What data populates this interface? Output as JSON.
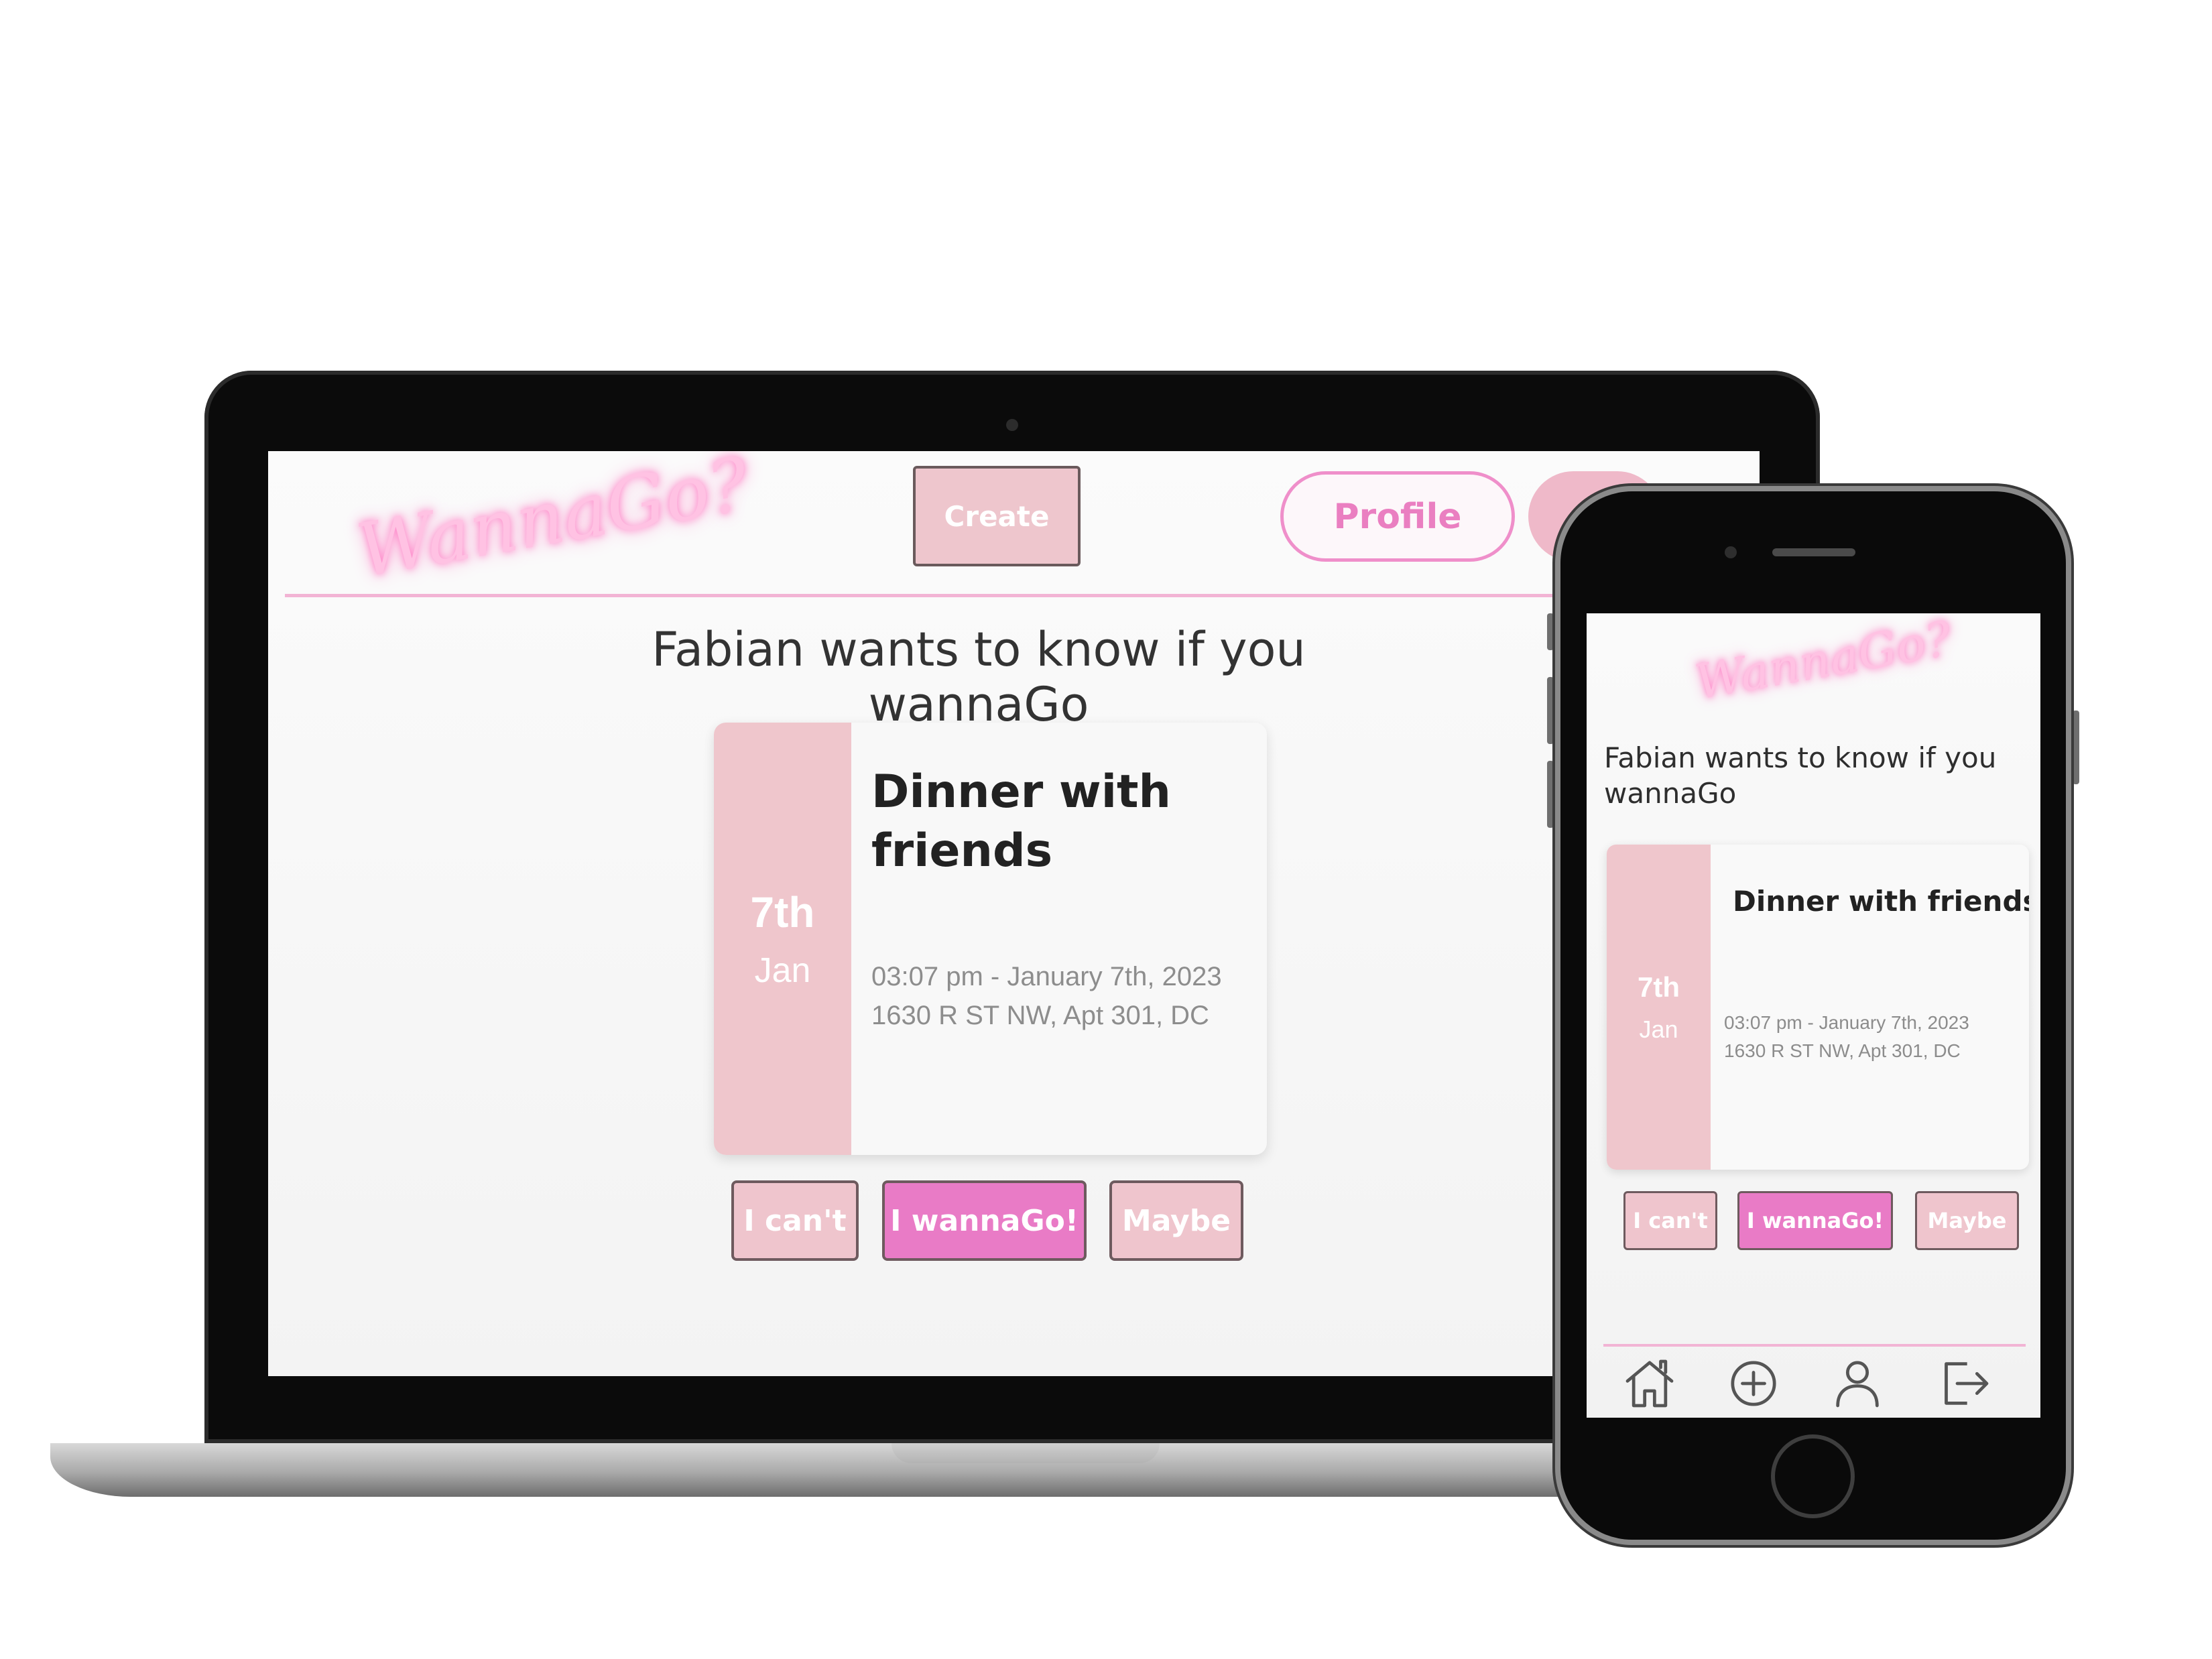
{
  "app": {
    "logo_text": "WannaGo?"
  },
  "laptop": {
    "header": {
      "create_label": "Create",
      "profile_label": "Profile"
    },
    "heading": "Fabian wants to know if you wannaGo",
    "event": {
      "day": "7th",
      "month": "Jan",
      "title": "Dinner with friends",
      "time": "03:07 pm - January 7th, 2023",
      "address": "1630 R ST NW, Apt 301, DC"
    },
    "actions": {
      "cant": "I can't",
      "go": "I wannaGo!",
      "maybe": "Maybe"
    }
  },
  "phone": {
    "heading": "Fabian wants to know if you wannaGo",
    "event": {
      "day": "7th",
      "month": "Jan",
      "title": "Dinner with friends",
      "time": "03:07 pm - January 7th, 2023",
      "address": "1630 R ST NW, Apt 301, DC"
    },
    "actions": {
      "cant": "I can't",
      "go": "I wannaGo!",
      "maybe": "Maybe"
    },
    "nav_icons": [
      "home-icon",
      "add-circle-icon",
      "user-icon",
      "logout-icon"
    ]
  },
  "colors": {
    "accent_pink": "#e97bc6",
    "soft_pink": "#efc5cd",
    "divider_pink": "#f2b4d4",
    "logo_glow": "#ff7ac4"
  }
}
